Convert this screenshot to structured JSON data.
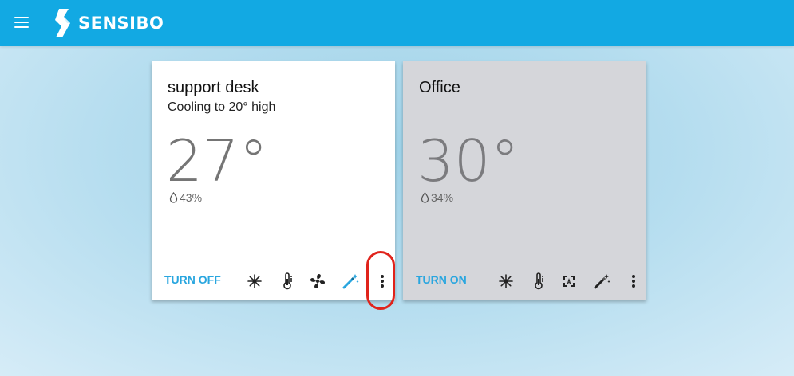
{
  "app": {
    "brand": "SENSIBO",
    "brand_color": "#12a9e3"
  },
  "devices": [
    {
      "name": "support desk",
      "status": "Cooling to 20° high",
      "temperature": "27°",
      "humidity": "43%",
      "power_label": "TURN OFF",
      "state": "on",
      "mode_icons": [
        "snowflake-icon",
        "thermometer-icon",
        "fan-icon",
        "magic-wand-icon"
      ],
      "active_icon": "magic-wand-icon"
    },
    {
      "name": "Office",
      "status": "",
      "temperature": "30°",
      "humidity": "34%",
      "power_label": "TURN ON",
      "state": "off",
      "mode_icons": [
        "snowflake-icon",
        "thermometer-icon",
        "fan-auto-icon",
        "magic-wand-icon"
      ]
    }
  ],
  "colors": {
    "accent": "#29a6df",
    "highlight": "#e0231b",
    "card_off_bg": "#d5d6da"
  }
}
